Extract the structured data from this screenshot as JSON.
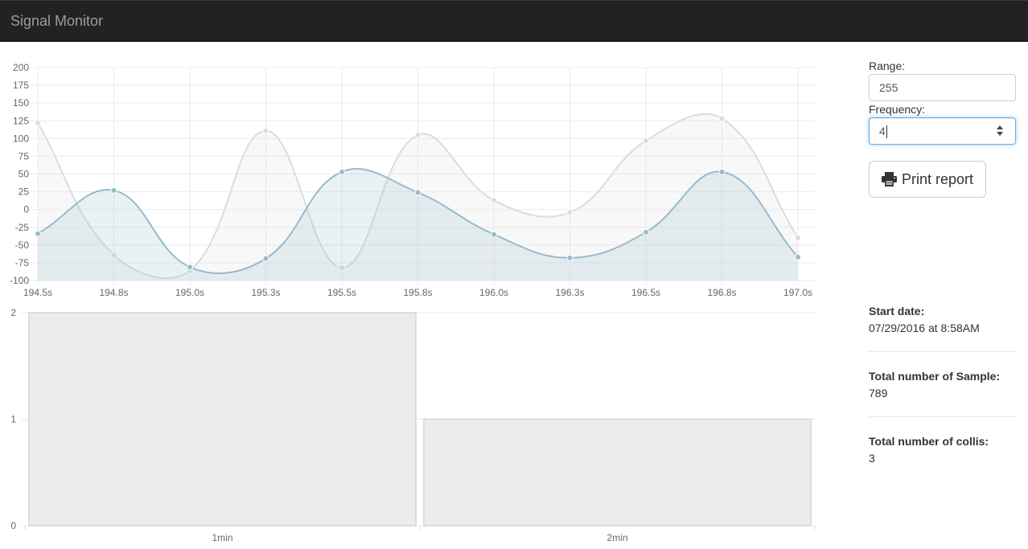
{
  "navbar": {
    "brand": "Signal Monitor"
  },
  "controls": {
    "range_label": "Range:",
    "range_value": "255",
    "frequency_label": "Frequency:",
    "frequency_value": "4",
    "print_label": "Print report"
  },
  "stats": {
    "start_date_label": "Start date:",
    "start_date_value": "07/29/2016 at 8:58AM",
    "samples_label": "Total number of Sample:",
    "samples_value": "789",
    "collis_label": "Total number of collis:",
    "collis_value": "3"
  },
  "colors": {
    "series_grey": "#dcdcdc",
    "series_blue": "#97bbcd",
    "bar_fill": "#ececec",
    "bar_border": "#dcdcdc",
    "focus_border": "#66afe9",
    "navbar_bg": "#222222"
  },
  "chart_data": [
    {
      "type": "line",
      "x": [
        "194.5s",
        "194.8s",
        "195.0s",
        "195.3s",
        "195.5s",
        "195.8s",
        "196.0s",
        "196.3s",
        "196.5s",
        "196.8s",
        "197.0s"
      ],
      "ylim": [
        -100,
        200
      ],
      "yticks": [
        -100,
        -75,
        -50,
        -25,
        0,
        25,
        50,
        75,
        100,
        125,
        150,
        175,
        200
      ],
      "grid": true,
      "series": [
        {
          "values": [
            122,
            -64,
            -86,
            111,
            -82,
            105,
            13,
            -4,
            97,
            128,
            -40
          ]
        },
        {
          "values": [
            -34,
            27,
            -81,
            -69,
            53,
            24,
            -35,
            -68,
            -32,
            53,
            -67
          ]
        }
      ]
    },
    {
      "type": "bar",
      "categories": [
        "1min",
        "2min"
      ],
      "values": [
        2,
        1
      ],
      "ylim": [
        0,
        2
      ],
      "yticks": [
        0,
        1,
        2
      ],
      "grid": true
    }
  ]
}
